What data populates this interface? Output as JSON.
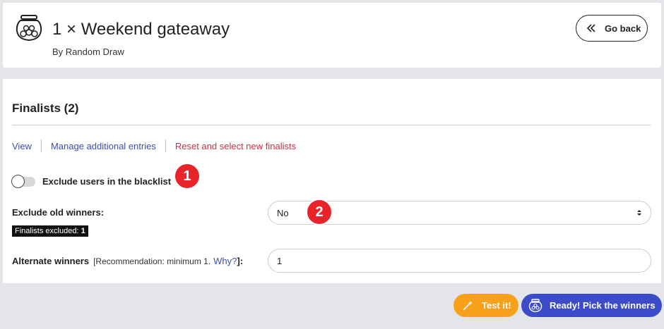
{
  "header": {
    "title": "1 × Weekend gateaway",
    "subtitle": "By Random Draw",
    "go_back_label": "Go back",
    "icon": "bowl-draw-icon"
  },
  "finalists": {
    "section_title": "Finalists (2)",
    "tabs": [
      {
        "label": "View"
      },
      {
        "label": "Manage additional entries"
      },
      {
        "label": "Reset and select new finalists"
      }
    ],
    "blacklist_toggle": {
      "label": "Exclude users in the blacklist",
      "on": false
    },
    "old_winners": {
      "label": "Exclude old winners:",
      "selected": "No",
      "badge_text": "Finalists excluded:",
      "badge_count": "1"
    },
    "alternate": {
      "label": "Alternate winners",
      "hint": "[Recommendation: minimum 1.",
      "why": "Why?",
      "hint_end": "]:",
      "value": "1"
    }
  },
  "markers": [
    "1",
    "2"
  ],
  "actions": {
    "test_label": "Test it!",
    "pick_label": "Ready! Pick the winners"
  },
  "colors": {
    "accent_blue": "#3c4cc8",
    "link_blue": "#3a4fb0",
    "reset_red": "#c4334b",
    "test_orange": "#f7a11a",
    "marker_red": "#e8232a"
  }
}
